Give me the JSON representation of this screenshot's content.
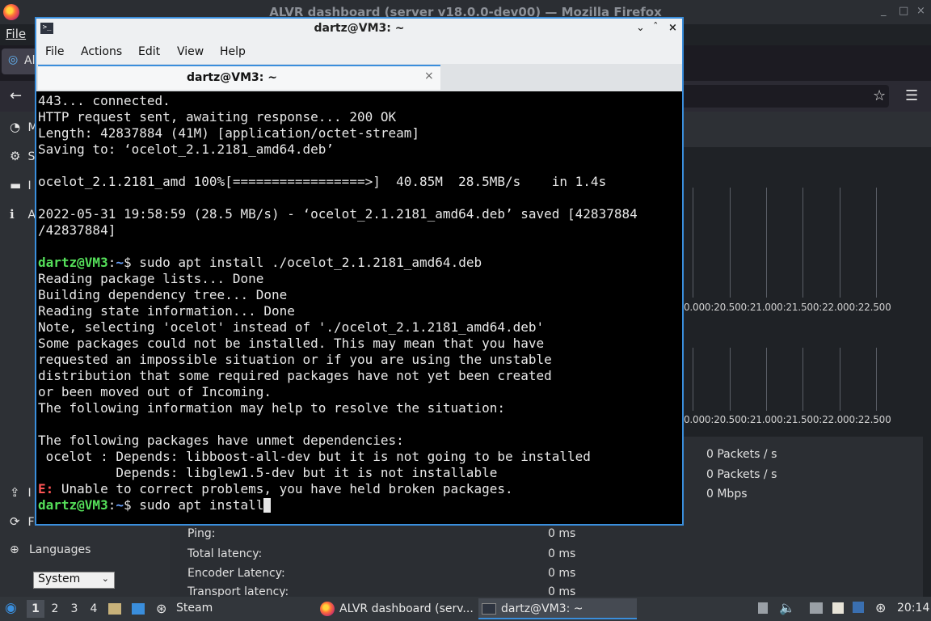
{
  "firefox": {
    "window_title": "ALVR dashboard (server v18.0.0-dev00) — Mozilla Firefox",
    "menu_file": "File",
    "tab_label": "Al",
    "window_controls": [
      "_",
      "□",
      "×"
    ]
  },
  "alvr": {
    "sidebar_items_top": [
      {
        "icon": "dashboard-icon",
        "glyph": "◔",
        "label": "M"
      },
      {
        "icon": "settings-icon",
        "glyph": "⚙",
        "label": "S"
      },
      {
        "icon": "installation-icon",
        "glyph": "▬",
        "label": "I"
      },
      {
        "icon": "about-icon",
        "glyph": "ℹ",
        "label": "A"
      }
    ],
    "sidebar_items_bottom": [
      {
        "icon": "upload-icon",
        "glyph": "⇪",
        "label": "I"
      },
      {
        "icon": "reload-icon",
        "glyph": "⟳",
        "label": "F"
      }
    ],
    "languages_label": "Languages",
    "language_selected": "System",
    "graph1_axis": "0.000:20.500:21.000:21.500:22.000:22.500",
    "graph2_axis": "0.000:20.500:21.000:21.500:22.000:22.500",
    "right_stats": [
      "0 Packets / s",
      "0 Packets / s",
      "0 Mbps"
    ],
    "stats": [
      {
        "label": "Ping:",
        "value": "0 ms"
      },
      {
        "label": "Total latency:",
        "value": "0 ms"
      },
      {
        "label": "Encoder Latency:",
        "value": "0 ms"
      },
      {
        "label": "Transport latency:",
        "value": "0 ms"
      }
    ]
  },
  "terminal": {
    "title": "dartz@VM3: ~",
    "window_controls": [
      "⌄",
      "ˆ",
      "×"
    ],
    "menu": [
      "File",
      "Actions",
      "Edit",
      "View",
      "Help"
    ],
    "tab_label": "dartz@VM3: ~",
    "prompt_user": "dartz@VM3",
    "prompt_path": "~",
    "lines": [
      {
        "type": "text",
        "text": "443... connected."
      },
      {
        "type": "text",
        "text": "HTTP request sent, awaiting response... 200 OK"
      },
      {
        "type": "text",
        "text": "Length: 42837884 (41M) [application/octet-stream]"
      },
      {
        "type": "text",
        "text": "Saving to: ‘ocelot_2.1.2181_amd64.deb’"
      },
      {
        "type": "text",
        "text": ""
      },
      {
        "type": "text",
        "text": "ocelot_2.1.2181_amd 100%[=================>]  40.85M  28.5MB/s    in 1.4s"
      },
      {
        "type": "text",
        "text": ""
      },
      {
        "type": "text",
        "text": "2022-05-31 19:58:59 (28.5 MB/s) - ‘ocelot_2.1.2181_amd64.deb’ saved [42837884"
      },
      {
        "type": "text",
        "text": "/42837884]"
      },
      {
        "type": "text",
        "text": ""
      },
      {
        "type": "prompt",
        "text": "sudo apt install ./ocelot_2.1.2181_amd64.deb"
      },
      {
        "type": "text",
        "text": "Reading package lists... Done"
      },
      {
        "type": "text",
        "text": "Building dependency tree... Done"
      },
      {
        "type": "text",
        "text": "Reading state information... Done"
      },
      {
        "type": "text",
        "text": "Note, selecting 'ocelot' instead of './ocelot_2.1.2181_amd64.deb'"
      },
      {
        "type": "text",
        "text": "Some packages could not be installed. This may mean that you have"
      },
      {
        "type": "text",
        "text": "requested an impossible situation or if you are using the unstable"
      },
      {
        "type": "text",
        "text": "distribution that some required packages have not yet been created"
      },
      {
        "type": "text",
        "text": "or been moved out of Incoming."
      },
      {
        "type": "text",
        "text": "The following information may help to resolve the situation:"
      },
      {
        "type": "text",
        "text": ""
      },
      {
        "type": "text",
        "text": "The following packages have unmet dependencies:"
      },
      {
        "type": "text",
        "text": " ocelot : Depends: libboost-all-dev but it is not going to be installed"
      },
      {
        "type": "text",
        "text": "          Depends: libglew1.5-dev but it is not installable"
      },
      {
        "type": "error",
        "prefix": "E:",
        "text": " Unable to correct problems, you have held broken packages."
      },
      {
        "type": "prompt-current",
        "text": "sudo apt install"
      }
    ]
  },
  "taskbar": {
    "workspaces": [
      "1",
      "2",
      "3",
      "4"
    ],
    "steam_label": "Steam",
    "tasks": [
      {
        "label": "ALVR dashboard (serv..."
      },
      {
        "label": "dartz@VM3: ~"
      }
    ],
    "clock": "20:14"
  }
}
